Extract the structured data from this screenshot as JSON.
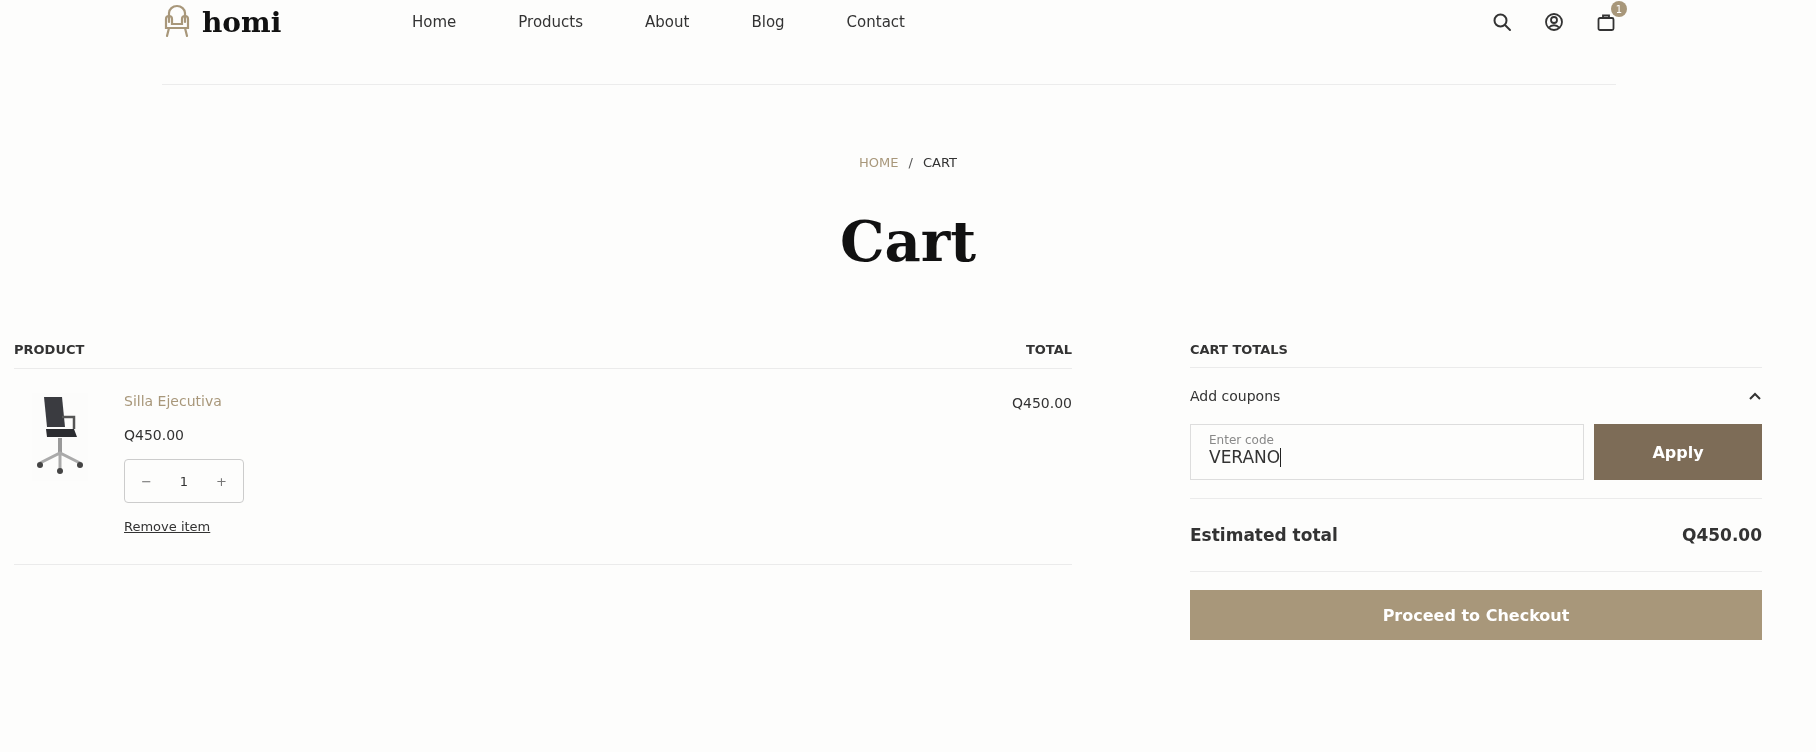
{
  "header": {
    "logo": "homi",
    "nav": [
      {
        "label": "Home"
      },
      {
        "label": "Products"
      },
      {
        "label": "About"
      },
      {
        "label": "Blog"
      },
      {
        "label": "Contact"
      }
    ],
    "cart_count": "1"
  },
  "breadcrumb": [
    "HOME",
    "/",
    "CART"
  ],
  "title": "Cart",
  "table": {
    "columns": [
      "PRODUCT",
      "TOTAL"
    ],
    "rows": [
      {
        "name": "Silla Ejecutiva",
        "price": "Q450.00",
        "quantity": "1",
        "decrease": "−",
        "increase": "+",
        "remove": "Remove item",
        "total": "Q450.00"
      }
    ]
  },
  "totals": {
    "heading": "CART TOTALS",
    "coupons": {
      "label": "Add coupons",
      "expanded": true,
      "field_label": "Enter code",
      "value": "VERANO",
      "button": "Apply"
    },
    "estimated_label": "Estimated total",
    "estimated_value": "Q450.00",
    "checkout": "Proceed to Checkout"
  }
}
